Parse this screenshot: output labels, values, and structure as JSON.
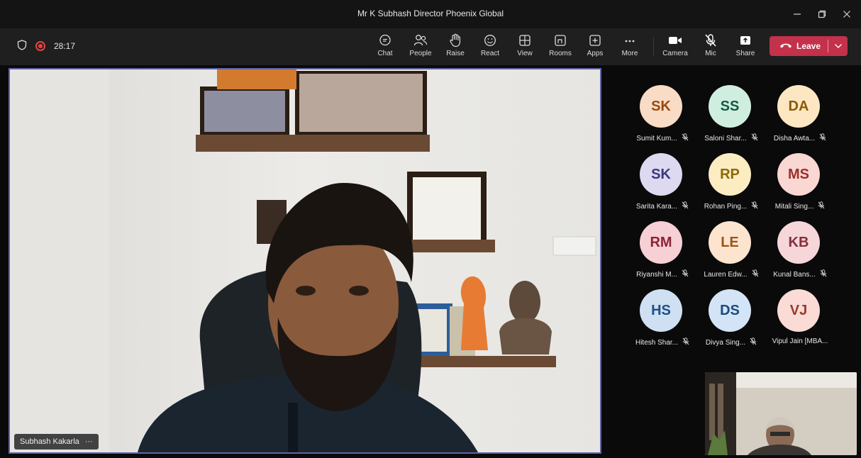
{
  "window": {
    "title": "Mr K Subhash Director Phoenix Global"
  },
  "meeting": {
    "timer": "28:17"
  },
  "toolbar": {
    "items": [
      {
        "label": "Chat",
        "icon": "chat-icon"
      },
      {
        "label": "People",
        "icon": "people-icon"
      },
      {
        "label": "Raise",
        "icon": "raise-hand-icon"
      },
      {
        "label": "React",
        "icon": "react-icon"
      },
      {
        "label": "View",
        "icon": "view-icon"
      },
      {
        "label": "Rooms",
        "icon": "rooms-icon"
      },
      {
        "label": "Apps",
        "icon": "apps-icon"
      },
      {
        "label": "More",
        "icon": "more-icon"
      },
      {
        "label": "Camera",
        "icon": "camera-icon"
      },
      {
        "label": "Mic",
        "icon": "mic-off-icon"
      },
      {
        "label": "Share",
        "icon": "share-icon"
      }
    ],
    "leave_label": "Leave"
  },
  "main_video": {
    "speaker_name": "Subhash Kakarla",
    "more_label": "···"
  },
  "participants": [
    {
      "initials": "SK",
      "name": "Sumit Kum...",
      "bg": "#f9dcc6",
      "fg": "#9a4a12"
    },
    {
      "initials": "SS",
      "name": "Saloni Shar...",
      "bg": "#cfeee0",
      "fg": "#145a43"
    },
    {
      "initials": "DA",
      "name": "Disha Awta...",
      "bg": "#fde7c3",
      "fg": "#8a5a08"
    },
    {
      "initials": "SK",
      "name": "Sarita Kara...",
      "bg": "#dcd9f0",
      "fg": "#3b3780"
    },
    {
      "initials": "RP",
      "name": "Rohan Ping...",
      "bg": "#fbecc2",
      "fg": "#8a6a08"
    },
    {
      "initials": "MS",
      "name": "Mitali Sing...",
      "bg": "#f9d7d2",
      "fg": "#9a2f28"
    },
    {
      "initials": "RM",
      "name": "Riyanshi M...",
      "bg": "#f6d0d5",
      "fg": "#8e2236"
    },
    {
      "initials": "LE",
      "name": "Lauren Edw...",
      "bg": "#fde4cf",
      "fg": "#9a5418"
    },
    {
      "initials": "KB",
      "name": "Kunal Bans...",
      "bg": "#f6d6d9",
      "fg": "#86303d"
    },
    {
      "initials": "HS",
      "name": "Hitesh Shar...",
      "bg": "#cfe0f3",
      "fg": "#1e4f86"
    },
    {
      "initials": "DS",
      "name": "Divya Sing...",
      "bg": "#d3e4f6",
      "fg": "#1c4a7c"
    },
    {
      "initials": "VJ",
      "name": "Vipul Jain [MBA...",
      "bg": "#fadbd6",
      "fg": "#9a3a2c"
    }
  ],
  "colors": {
    "accent": "#6264a7",
    "leave": "#c4314b",
    "recording": "#e5453f"
  }
}
